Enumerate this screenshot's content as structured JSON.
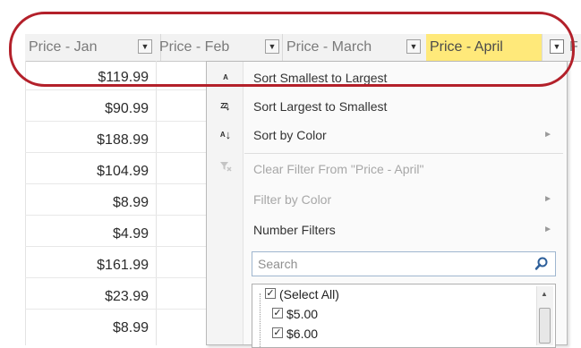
{
  "headers": [
    {
      "label": "Price - Jan",
      "active": false
    },
    {
      "label": "Price - Feb",
      "active": false
    },
    {
      "label": "Price - March",
      "active": false
    },
    {
      "label": "Price - April",
      "active": true
    },
    {
      "label": "F",
      "active": false
    }
  ],
  "dropdown_glyph": "▼",
  "prices": [
    "$119.99",
    "$90.99",
    "$188.99",
    "$104.99",
    "$8.99",
    "$4.99",
    "$161.99",
    "$23.99",
    "$8.99"
  ],
  "menu": {
    "sort_asc": {
      "label": "Sort Smallest to Largest",
      "icon": "sort-ascending-icon",
      "glyph": "↓"
    },
    "sort_desc": {
      "label": "Sort Largest to Smallest",
      "icon": "sort-descending-icon",
      "glyph": "↓"
    },
    "sort_color": {
      "label": "Sort by Color",
      "arrow": "►"
    },
    "clear_filter": {
      "label": "Clear Filter From \"Price - April\"",
      "icon": "clear-filter-icon"
    },
    "filter_color": {
      "label": "Filter by Color",
      "arrow": "►"
    },
    "number_filters": {
      "label": "Number Filters",
      "arrow": "►"
    }
  },
  "search": {
    "placeholder": "Search"
  },
  "checklist": [
    {
      "label": "(Select All)",
      "checked": true
    },
    {
      "label": "$5.00",
      "checked": true
    },
    {
      "label": "$6.00",
      "checked": true
    }
  ],
  "colors": {
    "highlight_header": "#ffe97a",
    "annotation_oval": "#b3202a"
  }
}
